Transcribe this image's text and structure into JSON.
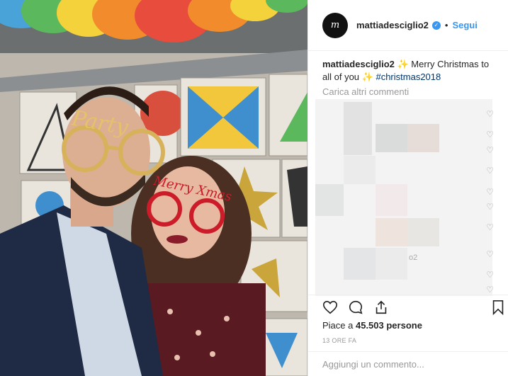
{
  "header": {
    "avatar_initial": "m",
    "username": "mattiadesciglio2",
    "separator": "•",
    "follow_label": "Segui"
  },
  "caption": {
    "username": "mattiadesciglio2",
    "sparkle": "✨",
    "text": " Merry Christmas to all of you ",
    "sparkle2": "✨",
    "hashtag": "#christmas2018"
  },
  "comments": {
    "load_more_label": "Carica altri commenti",
    "blurred_text": "o2",
    "heart_glyph": "♡"
  },
  "likes": {
    "prefix": "Piace a ",
    "count": "45.503",
    "suffix": " persone"
  },
  "timestamp": "13 ORE FA",
  "add_comment": {
    "placeholder": "Aggiungi un commento..."
  },
  "photo": {
    "glasses_left_text": "Party",
    "glasses_right_text": "Merry Xmas"
  },
  "colors": {
    "accent": "#3897f0",
    "hashtag": "#003569",
    "muted": "#999999"
  }
}
